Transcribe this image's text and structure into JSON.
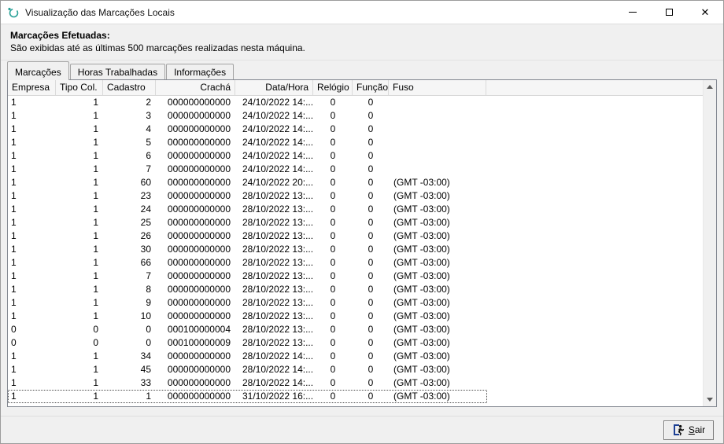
{
  "window": {
    "title": "Visualização das Marcações Locais"
  },
  "header": {
    "title": "Marcações Efetuadas:",
    "subtitle": "São exibidas até as últimas 500 marcações realizadas nesta máquina."
  },
  "tabs": [
    {
      "label": "Marcações",
      "active": true
    },
    {
      "label": "Horas Trabalhadas",
      "active": false
    },
    {
      "label": "Informações",
      "active": false
    }
  ],
  "table": {
    "columns": [
      "Empresa",
      "Tipo Col.",
      "Cadastro",
      "Crachá",
      "Data/Hora",
      "Relógio",
      "Função",
      "Fuso"
    ],
    "rows": [
      [
        "1",
        "1",
        "2",
        "000000000000",
        "24/10/2022 14:...",
        "0",
        "0",
        ""
      ],
      [
        "1",
        "1",
        "3",
        "000000000000",
        "24/10/2022 14:...",
        "0",
        "0",
        ""
      ],
      [
        "1",
        "1",
        "4",
        "000000000000",
        "24/10/2022 14:...",
        "0",
        "0",
        ""
      ],
      [
        "1",
        "1",
        "5",
        "000000000000",
        "24/10/2022 14:...",
        "0",
        "0",
        ""
      ],
      [
        "1",
        "1",
        "6",
        "000000000000",
        "24/10/2022 14:...",
        "0",
        "0",
        ""
      ],
      [
        "1",
        "1",
        "7",
        "000000000000",
        "24/10/2022 14:...",
        "0",
        "0",
        ""
      ],
      [
        "1",
        "1",
        "60",
        "000000000000",
        "24/10/2022 20:...",
        "0",
        "0",
        "(GMT -03:00)"
      ],
      [
        "1",
        "1",
        "23",
        "000000000000",
        "28/10/2022 13:...",
        "0",
        "0",
        "(GMT -03:00)"
      ],
      [
        "1",
        "1",
        "24",
        "000000000000",
        "28/10/2022 13:...",
        "0",
        "0",
        "(GMT -03:00)"
      ],
      [
        "1",
        "1",
        "25",
        "000000000000",
        "28/10/2022 13:...",
        "0",
        "0",
        "(GMT -03:00)"
      ],
      [
        "1",
        "1",
        "26",
        "000000000000",
        "28/10/2022 13:...",
        "0",
        "0",
        "(GMT -03:00)"
      ],
      [
        "1",
        "1",
        "30",
        "000000000000",
        "28/10/2022 13:...",
        "0",
        "0",
        "(GMT -03:00)"
      ],
      [
        "1",
        "1",
        "66",
        "000000000000",
        "28/10/2022 13:...",
        "0",
        "0",
        "(GMT -03:00)"
      ],
      [
        "1",
        "1",
        "7",
        "000000000000",
        "28/10/2022 13:...",
        "0",
        "0",
        "(GMT -03:00)"
      ],
      [
        "1",
        "1",
        "8",
        "000000000000",
        "28/10/2022 13:...",
        "0",
        "0",
        "(GMT -03:00)"
      ],
      [
        "1",
        "1",
        "9",
        "000000000000",
        "28/10/2022 13:...",
        "0",
        "0",
        "(GMT -03:00)"
      ],
      [
        "1",
        "1",
        "10",
        "000000000000",
        "28/10/2022 13:...",
        "0",
        "0",
        "(GMT -03:00)"
      ],
      [
        "0",
        "0",
        "0",
        "000100000004",
        "28/10/2022 13:...",
        "0",
        "0",
        "(GMT -03:00)"
      ],
      [
        "0",
        "0",
        "0",
        "000100000009",
        "28/10/2022 13:...",
        "0",
        "0",
        "(GMT -03:00)"
      ],
      [
        "1",
        "1",
        "34",
        "000000000000",
        "28/10/2022 14:...",
        "0",
        "0",
        "(GMT -03:00)"
      ],
      [
        "1",
        "1",
        "45",
        "000000000000",
        "28/10/2022 14:...",
        "0",
        "0",
        "(GMT -03:00)"
      ],
      [
        "1",
        "1",
        "33",
        "000000000000",
        "28/10/2022 14:...",
        "0",
        "0",
        "(GMT -03:00)"
      ],
      [
        "1",
        "1",
        "1",
        "000000000000",
        "31/10/2022 16:...",
        "0",
        "0",
        "(GMT -03:00)"
      ]
    ],
    "selected_row_index": 22
  },
  "footer": {
    "exit_initial": "S",
    "exit_rest": "air"
  },
  "icons": {
    "app_icon": "teal-circular-logo",
    "minimize_icon": "minimize-bar",
    "maximize_icon": "maximize-square",
    "close_icon": "✕",
    "exit_icon": "running-man-through-door",
    "scroll_up_icon": "▲",
    "scroll_down_icon": "▼"
  },
  "colors": {
    "titlebar_bg": "#ffffff",
    "window_bg": "#f0f0f0",
    "list_bg": "#ffffff",
    "list_border": "#828790",
    "app_icon_teal": "#2aa198",
    "selection_focus": "#4a4a4a"
  }
}
